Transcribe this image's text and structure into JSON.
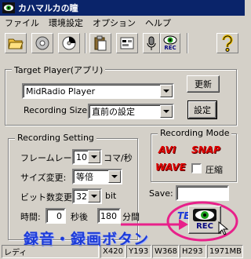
{
  "window": {
    "title": "カハマルカの瞳"
  },
  "menu": [
    "ファイル",
    "環境設定",
    "オプション",
    "ヘルプ"
  ],
  "toolbar": {
    "icons": [
      "open-folder-icon",
      "disc-icon",
      "blank-disc-icon",
      "clipboard-icon",
      "settings-icon",
      "audio-icon",
      "rec-eye-icon",
      "help-icon"
    ],
    "rec_label": "REC"
  },
  "target": {
    "legend": "Target Player(アプリ)",
    "player_value": "MidRadio Player",
    "update_button": "更新",
    "size_label": "Recording Size:",
    "size_value": "直前の設定",
    "settings_button": "設定"
  },
  "recording": {
    "legend": "Recording Setting",
    "framerate_label": "フレームレート:",
    "framerate_value": "10",
    "framerate_unit": "コマ/秒",
    "size_change_label": "サイズ変更:",
    "size_change_value": "等倍",
    "bitdepth_label": "ビット数変更:",
    "bitdepth_value": "32",
    "bitdepth_unit": "bit",
    "time_label": "時間:",
    "delay_value": "0",
    "delay_unit": "秒後",
    "duration_value": "180",
    "duration_unit": "分間"
  },
  "mode": {
    "legend": "Recording Mode",
    "avi_label": "AVI",
    "snap_label": "SNAP",
    "wave_label": "WAVE",
    "compress_label": "圧縮",
    "compress_checked": false,
    "save_label": "Save:",
    "save_value": "",
    "test_label": "TEST",
    "rec_label": "REC"
  },
  "annotation": "録音・録画ボタン",
  "status": {
    "state": "レディ",
    "x": "X420",
    "y": "Y193",
    "w": "W368",
    "h": "H293",
    "mem": "1971MB"
  },
  "colors": {
    "titlebar": "#0a246a",
    "face": "#d4d0c8",
    "badge_red": "#e00000",
    "annotation_blue": "#1c3bd8",
    "highlight_pink": "#e8208a",
    "rec_green": "#1aa01a"
  }
}
